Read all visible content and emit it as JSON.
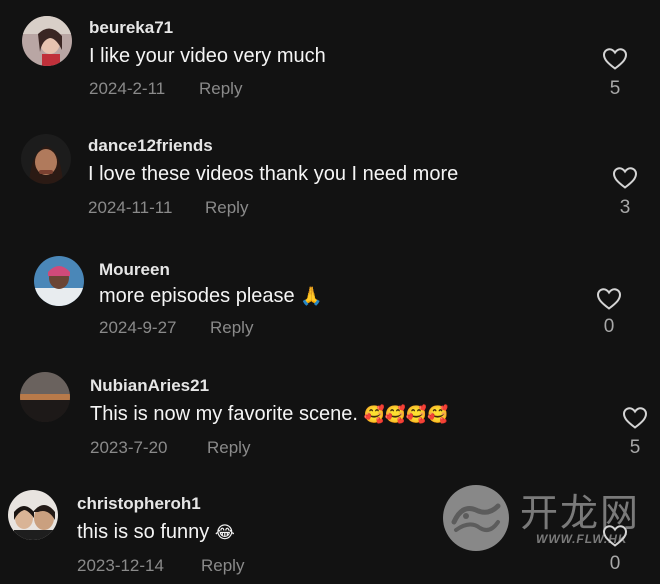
{
  "comments": [
    {
      "username": "beureka71",
      "text": "I like your video very much",
      "date": "2024-2-11",
      "reply": "Reply",
      "likes": "5",
      "avatar": "selfie-woman"
    },
    {
      "username": "dance12friends",
      "text": "I love these videos thank you I need more",
      "date": "2024-11-11",
      "reply": "Reply",
      "likes": "3",
      "avatar": "portrait-woman"
    },
    {
      "username": "Moureen",
      "text": "more episodes please",
      "emoji": "🙏",
      "date": "2024-9-27",
      "reply": "Reply",
      "likes": "0",
      "avatar": "portrait-woman-blue"
    },
    {
      "username": "NubianAries21",
      "text": "This is now my favorite scene.",
      "emoji": "🥰🥰🥰🥰",
      "date": "2023-7-20",
      "reply": "Reply",
      "likes": "5",
      "avatar": "sunset-landscape"
    },
    {
      "username": "christopheroh1",
      "text": "this is so funny",
      "emoji": "😂",
      "date": "2023-12-14",
      "reply": "Reply",
      "likes": "0",
      "avatar": "two-women"
    }
  ],
  "watermark": {
    "logo": "fengling-logo",
    "name_cn": "开龙网",
    "url": "WWW.FLW.HK"
  },
  "colors": {
    "background": "#121212",
    "text": "#f5f5f5",
    "muted": "#8a8a8a"
  }
}
